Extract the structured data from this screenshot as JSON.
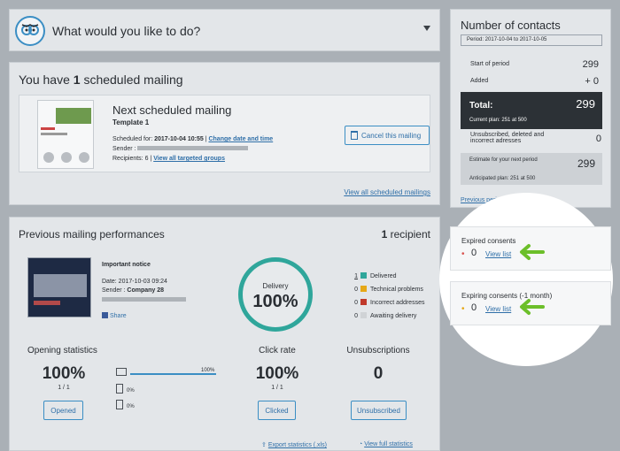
{
  "header": {
    "question": "What would you like to do?"
  },
  "scheduled": {
    "prefix": "You have ",
    "count": "1",
    "suffix": " scheduled mailing",
    "next_title": "Next scheduled mailing",
    "template": "Template 1",
    "scheduled_label": "Scheduled for: ",
    "scheduled_value": "2017-10-04 10:55",
    "sep": " | ",
    "change_link": "Change date and time",
    "sender_label": "Sender : ",
    "recipients_label": "Recipients: 6",
    "view_targeted": "View all targeted groups",
    "cancel_label": "Cancel this mailing",
    "view_all_link": "View all scheduled mailings"
  },
  "previous": {
    "title": "Previous mailing performances",
    "recipient_count": "1",
    "recipient_label": " recipient",
    "notice": "Important notice",
    "date_label": "Date: 2017-10-03 09:24",
    "sender_label": "Sender : ",
    "sender_value": "Company 28",
    "share": "Share",
    "delivery_label": "Delivery",
    "delivery_value": "100%",
    "legend": [
      {
        "n": "1",
        "label": "Delivered",
        "color": "#2fa69b"
      },
      {
        "n": "0",
        "label": "Technical problems",
        "color": "#e6a817"
      },
      {
        "n": "0",
        "label": "Incorrect addresses",
        "color": "#c0392b"
      },
      {
        "n": "0",
        "label": "Awaiting delivery",
        "color": "#d0d3d6"
      }
    ],
    "opening": {
      "title": "Opening statistics",
      "value": "100%",
      "ratio": "1 / 1",
      "button": "Opened",
      "desktop": "100%",
      "mobile": "0%",
      "tablet": "0%"
    },
    "click": {
      "title": "Click rate",
      "value": "100%",
      "ratio": "1 / 1",
      "button": "Clicked"
    },
    "unsub": {
      "title": "Unsubscriptions",
      "value": "0",
      "button": "Unsubscribed"
    },
    "export": "Export statistics (.xls)",
    "full": "View full statistics"
  },
  "contacts": {
    "title": "Number of contacts",
    "period": "Period: 2017-10-04 to 2017-10-05",
    "start_label": "Start of period",
    "start_value": "299",
    "added_label": "Added",
    "added_value": "+ 0",
    "total_label": "Total:",
    "total_value": "299",
    "current_plan": "Current plan: 251 at 500",
    "unsub_label": "Unsubscribed, deleted and incorrect adresses",
    "unsub_value": "0",
    "estimate_label": "Estimate for your next period",
    "estimate_value": "299",
    "anticipated": "Anticipated plan: 251 at 500",
    "previous_periods": "Previous periods"
  },
  "consents": {
    "expired": {
      "title": "Expired consents",
      "dot": "•",
      "value": "0",
      "link": "View list",
      "dot_color": "#d9534f"
    },
    "expiring": {
      "title": "Expiring consents (-1 month)",
      "dot": "•",
      "value": "0",
      "link": "View list",
      "dot_color": "#e6a817"
    },
    "arrow_color": "#6cbf2a"
  }
}
